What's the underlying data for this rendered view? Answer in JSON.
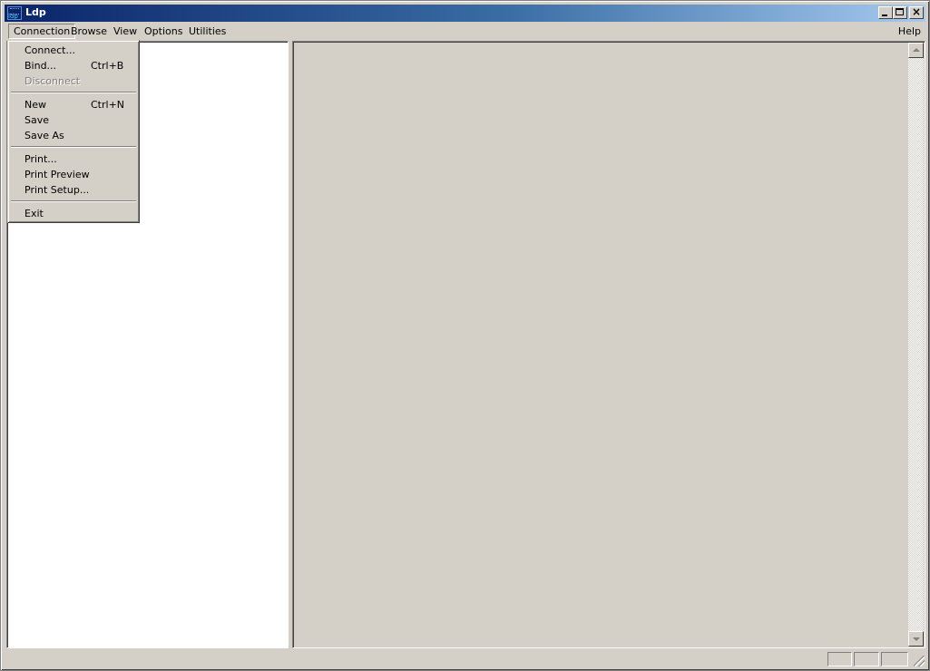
{
  "window": {
    "title": "Ldp",
    "icon": "ldp-app-icon"
  },
  "menubar": {
    "items": [
      "Connection",
      "Browse",
      "View",
      "Options",
      "Utilities"
    ],
    "help": "Help"
  },
  "connection_menu": {
    "connect": {
      "label": "Connect..."
    },
    "bind": {
      "label": "Bind...",
      "shortcut": "Ctrl+B"
    },
    "disconnect": {
      "label": "Disconnect",
      "disabled": true
    },
    "new": {
      "label": "New",
      "shortcut": "Ctrl+N"
    },
    "save": {
      "label": "Save"
    },
    "save_as": {
      "label": "Save As"
    },
    "print": {
      "label": "Print..."
    },
    "print_preview": {
      "label": "Print Preview"
    },
    "print_setup": {
      "label": "Print Setup..."
    },
    "exit": {
      "label": "Exit"
    }
  },
  "colors": {
    "title_gradient_start": "#0a246a",
    "title_gradient_end": "#a6caf0",
    "face": "#d4d0c8",
    "tree_background": "#ffffff",
    "disabled_text": "#808080"
  }
}
